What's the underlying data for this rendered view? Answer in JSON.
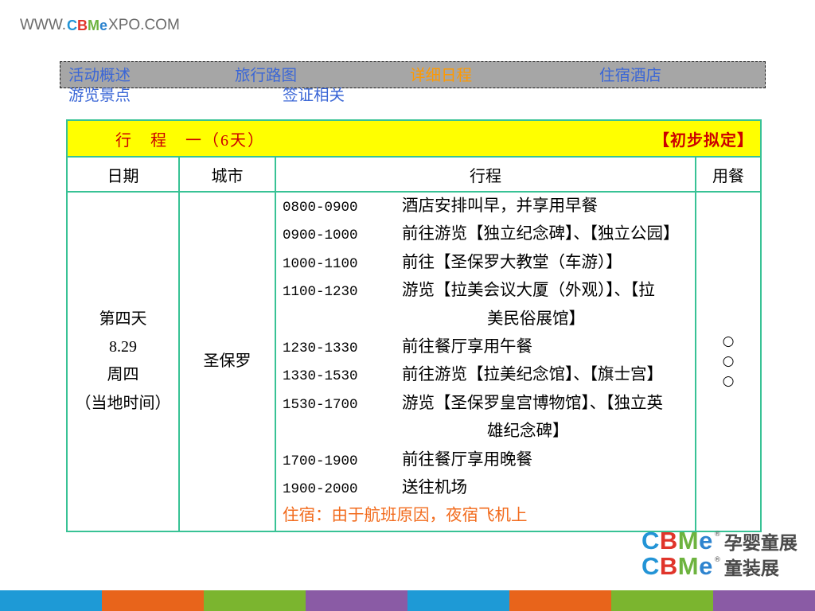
{
  "site_logo": {
    "prefix": "WWW.",
    "letters": [
      "C",
      "B",
      "M",
      "e"
    ],
    "suffix": "XPO.COM"
  },
  "nav": {
    "items": [
      {
        "label": "活动概述"
      },
      {
        "label": "旅行路图"
      },
      {
        "label": "详细日程",
        "active": true
      },
      {
        "label": "住宿酒店"
      },
      {
        "label": "游览景点"
      },
      {
        "label": "签证相关"
      }
    ]
  },
  "itinerary": {
    "title": "行　程　一（6天）",
    "status": "【初步拟定】",
    "headers": {
      "date": "日期",
      "city": "城市",
      "schedule": "行程",
      "meals": "用餐"
    },
    "day": {
      "label": "第四天",
      "date": "8.29",
      "weekday": "周四",
      "timezone_note": "（当地时间）"
    },
    "city": "圣保罗",
    "schedule": [
      {
        "time": "0800-0900",
        "activity": "酒店安排叫早，并享用早餐"
      },
      {
        "time": "0900-1000",
        "activity": "前往游览【独立纪念碑】、【独立公园】"
      },
      {
        "time": "1000-1100",
        "activity": "前往【圣保罗大教堂（车游）】"
      },
      {
        "time": "1100-1230",
        "activity": "游览【拉美会议大厦（外观）】、【拉",
        "activity_cont": "美民俗展馆】"
      },
      {
        "time": "1230-1330",
        "activity": "前往餐厅享用午餐"
      },
      {
        "time": "1330-1530",
        "activity": "前往游览【拉美纪念馆】、【旗士宫】"
      },
      {
        "time": "1530-1700",
        "activity": "游览【圣保罗皇宫博物馆】、【独立英",
        "activity_cont": "雄纪念碑】"
      },
      {
        "time": "1700-1900",
        "activity": "前往餐厅享用晚餐"
      },
      {
        "time": "1900-2000",
        "activity": "送往机场"
      }
    ],
    "accommodation": "住宿：由于航班原因，夜宿飞机上",
    "meals": [
      "○",
      "○",
      "○"
    ]
  },
  "brand_logo": {
    "letters": [
      "C",
      "B",
      "M",
      "e"
    ],
    "registered": "®",
    "exhibitions": [
      "孕婴童展",
      "童装展"
    ]
  },
  "colors": {
    "logo_gray": "#6b6b6b",
    "brand_c": "#2394d6",
    "brand_b": "#e0352b",
    "brand_m": "#6db33f",
    "brand_e": "#2e84cf",
    "nav_bg": "#a6a6a6",
    "nav_link": "#3a66d6",
    "nav_active": "#ff9900",
    "title_bg": "#ffff00",
    "title_text": "#cc0000",
    "table_border": "#38c295",
    "accommodation_text": "#f26b1d"
  },
  "bottom_bar": {
    "colors": [
      "#1e9ad6",
      "#e8641b",
      "#7bb52f",
      "#8a5ba5",
      "#1e9ad6",
      "#e8641b",
      "#7bb52f",
      "#8a5ba5"
    ]
  }
}
